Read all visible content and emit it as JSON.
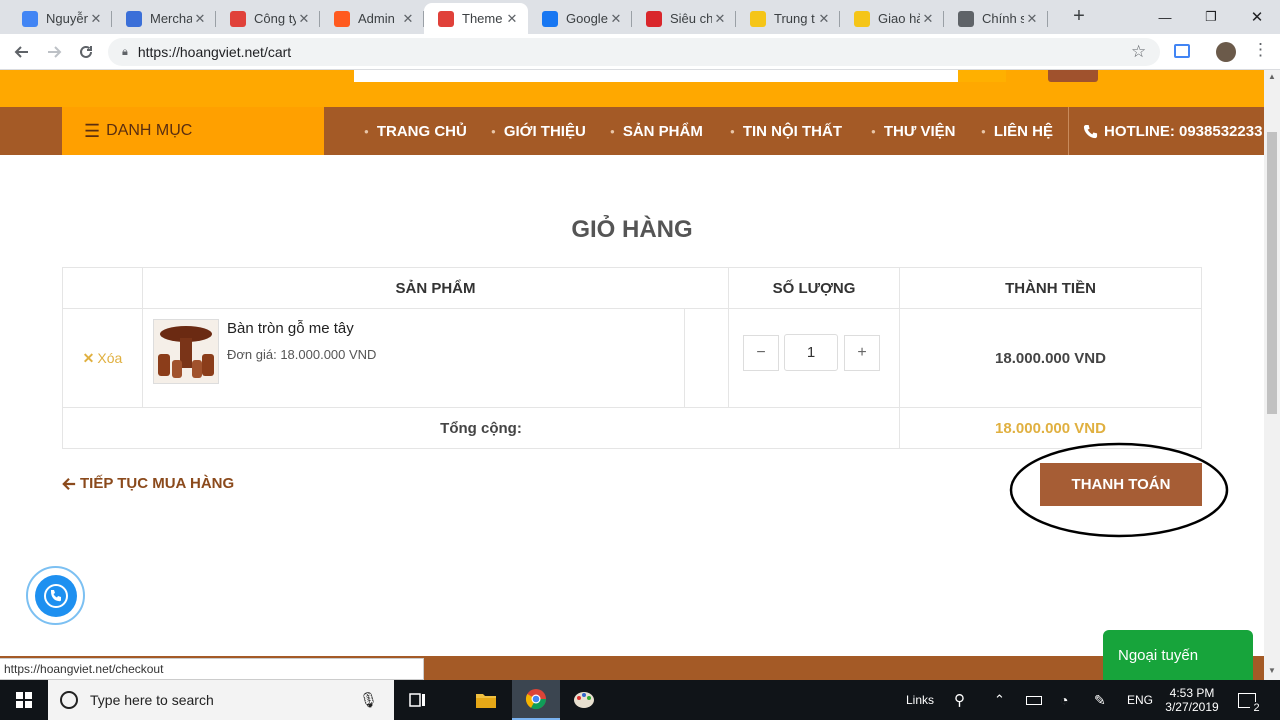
{
  "browser": {
    "tabs": [
      {
        "title": "Nguyễn",
        "icon": "google-ads-icon",
        "color": "#4285f4"
      },
      {
        "title": "Mercha",
        "icon": "merchant-center-icon",
        "color": "#3b6fd8"
      },
      {
        "title": "Công ty",
        "icon": "site-favicon-icon",
        "color": "#e0413a"
      },
      {
        "title": "Admin",
        "icon": "admin-favicon-icon",
        "color": "#ff5a1f"
      },
      {
        "title": "Theme",
        "icon": "theme-favicon-icon",
        "color": "#e0413a",
        "active": true
      },
      {
        "title": "Google",
        "icon": "facebook-icon",
        "color": "#1877f2"
      },
      {
        "title": "Siêu ch",
        "icon": "red-s-icon",
        "color": "#d9262b"
      },
      {
        "title": "Trung t",
        "icon": "delivery-icon",
        "color": "#f5c518"
      },
      {
        "title": "Giao hà",
        "icon": "delivery-icon",
        "color": "#f5c518"
      },
      {
        "title": "Chính s",
        "icon": "loading-icon",
        "color": "#5f6368"
      }
    ],
    "close_glyph": "✕",
    "new_tab_glyph": "+",
    "window_controls": {
      "minimize": "—",
      "restore": "❐",
      "close": "✕"
    },
    "url": "https://hoangviet.net/cart"
  },
  "site": {
    "category_label": "DANH MỤC",
    "menu": [
      "TRANG CHỦ",
      "GIỚI THIỆU",
      "SẢN PHẨM",
      "TIN NỘI THẤT",
      "THƯ VIỆN",
      "LIÊN HỆ"
    ],
    "hotline": "HOTLINE: 0938532233"
  },
  "cart": {
    "title": "GIỎ HÀNG",
    "headers": {
      "product": "SẢN PHẨM",
      "quantity": "SỐ LƯỢNG",
      "total": "THÀNH TIỀN"
    },
    "item": {
      "remove_label": "Xóa",
      "name": "Bàn tròn gỗ me tây",
      "unit_price": "Đơn giá: 18.000.000 VND",
      "quantity": "1",
      "line_total": "18.000.000 VND"
    },
    "subtotal_label": "Tổng cộng:",
    "subtotal_value": "18.000.000 VND",
    "continue_label": "TIẾP TỤC MUA HÀNG",
    "checkout_label": "THANH TOÁN"
  },
  "status_url": "https://hoangviet.net/checkout",
  "chat": {
    "offline_label": "Ngoại tuyến"
  },
  "taskbar": {
    "search_placeholder": "Type here to search",
    "links_label": "Links",
    "language": "ENG",
    "time": "4:53 PM",
    "date": "3/27/2019",
    "notification_count": "2"
  },
  "colors": {
    "accent": "#a45a26",
    "top_band": "#ffa800",
    "total_gold": "#e0b040"
  }
}
